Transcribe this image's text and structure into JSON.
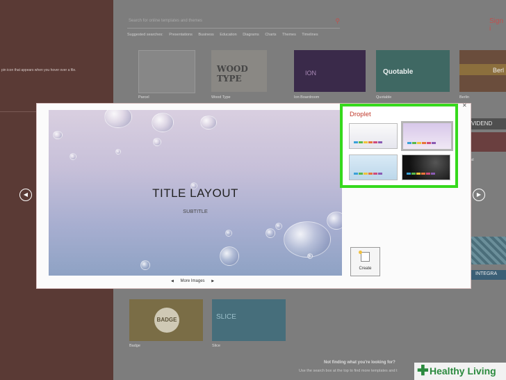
{
  "sidebar": {
    "hint_text": "pin icon that appears when you hover over a file."
  },
  "search": {
    "placeholder": "Search for online templates and themes",
    "signin_label": "Sign i"
  },
  "suggested": {
    "label": "Suggested searches:",
    "items": [
      "Presentations",
      "Business",
      "Education",
      "Diagrams",
      "Charts",
      "Themes",
      "Timelines"
    ]
  },
  "templates": {
    "row1": [
      {
        "label": "Parcel"
      },
      {
        "label": "Wood Type",
        "art": "WOOD TYPE"
      },
      {
        "label": "Ion Boardroom",
        "art": "ION"
      },
      {
        "label": "Quotable",
        "art": "Quotable"
      },
      {
        "label": "Berlin",
        "art": "Berl"
      }
    ],
    "right_column": {
      "dividend": "VIDEND",
      "dividend_caption": "nd",
      "integral": "INTEGRA"
    },
    "row3": [
      {
        "label": "Badge",
        "art": "BADGE"
      },
      {
        "label": "Slice",
        "art": "SLICE"
      }
    ]
  },
  "footer": {
    "not_finding": "Not finding what you're looking for?",
    "hint": "Use the search box at the top to find more templates and t"
  },
  "dialog": {
    "preview_title": "TITLE LAYOUT",
    "preview_subtitle": "SUBTITLE",
    "more_images": "More Images",
    "create_label": "Create",
    "close_glyph": "✕",
    "variants_title": "Droplet",
    "selected_variant": 2,
    "highlight_color": "#36d91d"
  },
  "nav": {
    "left_glyph": "◀",
    "right_glyph": "▶"
  },
  "watermark": {
    "text": "Healthy Living",
    "plus": "✚"
  },
  "colors": {
    "accent": "#c0504d",
    "variant_bars": [
      "#3aa0d8",
      "#5ab84b",
      "#f0c43a",
      "#e8743b",
      "#d04b7c",
      "#8a5bb3"
    ]
  }
}
